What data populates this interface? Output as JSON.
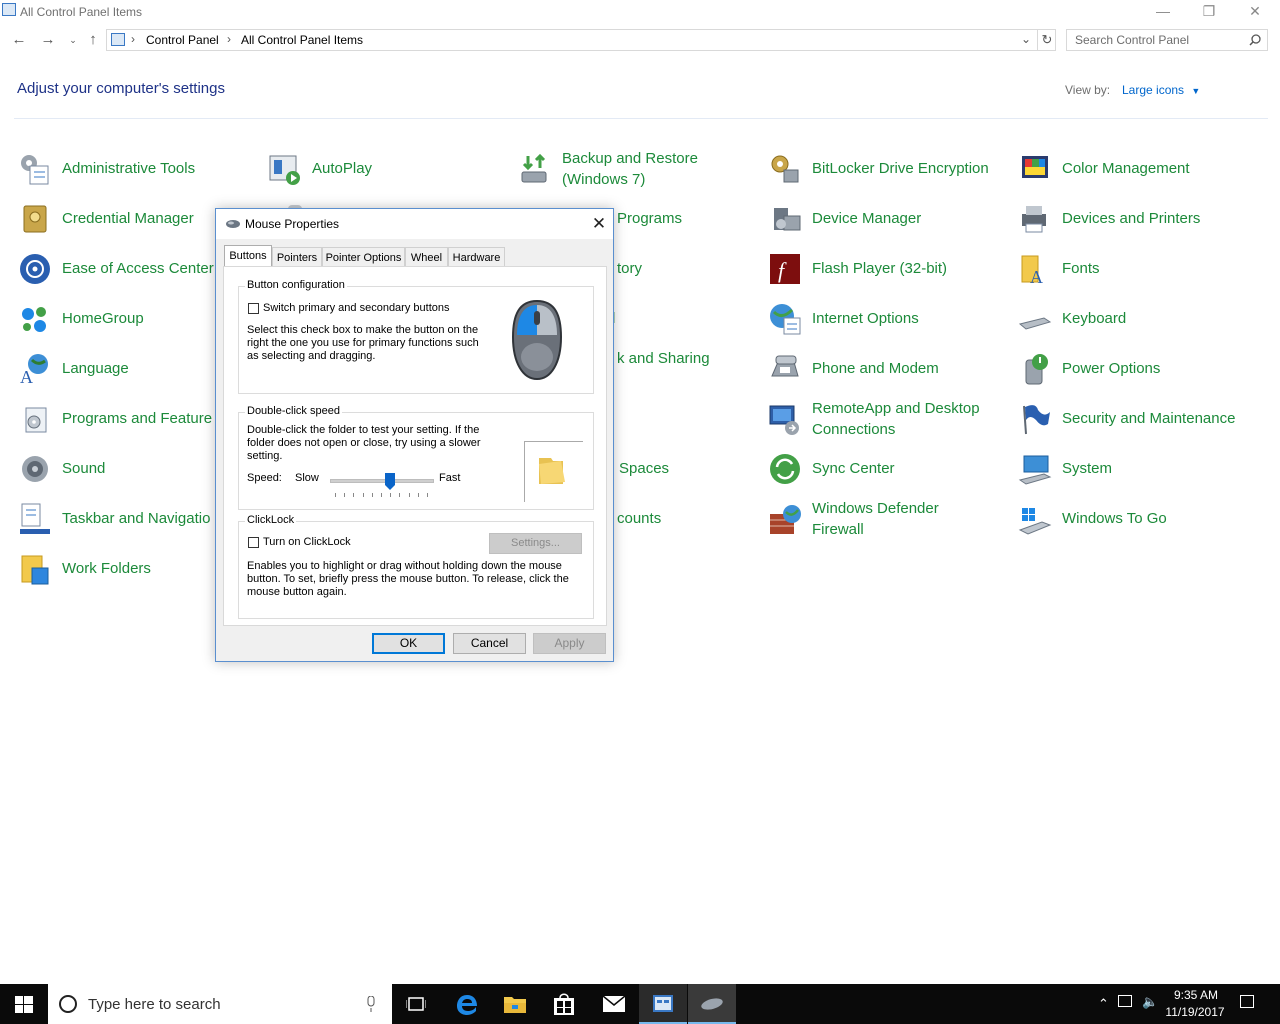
{
  "window": {
    "title": "All Control Panel Items",
    "minimize_glyph": "—",
    "restore_glyph": "❐",
    "close_glyph": "✕"
  },
  "address": {
    "crumbs": [
      "Control Panel",
      "All Control Panel Items"
    ],
    "search_placeholder": "Search Control Panel"
  },
  "header": {
    "title": "Adjust your computer's settings",
    "view_by_label": "View by:",
    "view_by_value": "Large icons"
  },
  "items": {
    "administrative_tools": "Administrative Tools",
    "autoplay": "AutoPlay",
    "backup_restore_1": "Backup and Restore",
    "backup_restore_2": "(Windows 7)",
    "bitlocker": "BitLocker Drive Encryption",
    "color_management": "Color Management",
    "credential_manager": "Credential Manager",
    "default_programs_partial": "Programs",
    "device_manager": "Device Manager",
    "devices_printers": "Devices and Printers",
    "ease_of_access": "Ease of Access Center",
    "file_history_partial": "tory",
    "flash_player": "Flash Player (32-bit)",
    "fonts": "Fonts",
    "homegroup": "HomeGroup",
    "indexing_partial": "l",
    "internet_options": "Internet Options",
    "keyboard": "Keyboard",
    "language": "Language",
    "network_sharing_partial": "k and Sharing",
    "phone_modem": "Phone and Modem",
    "power_options": "Power Options",
    "programs_features": "Programs and Feature",
    "remoteapp_1": "RemoteApp and Desktop",
    "remoteapp_2": "Connections",
    "security_maintenance": "Security and Maintenance",
    "sound": "Sound",
    "storage_spaces_partial": "Spaces",
    "sync_center": "Sync Center",
    "system": "System",
    "taskbar_navigation": "Taskbar and Navigatio",
    "user_accounts_partial": "counts",
    "windows_defender_1": "Windows Defender",
    "windows_defender_2": "Firewall",
    "windows_to_go": "Windows To Go",
    "work_folders": "Work Folders"
  },
  "dialog": {
    "title": "Mouse Properties",
    "close_glyph": "✕",
    "tabs": [
      "Buttons",
      "Pointers",
      "Pointer Options",
      "Wheel",
      "Hardware"
    ],
    "active_tab": "Buttons",
    "button_config": {
      "title": "Button configuration",
      "checkbox_label": "Switch primary and secondary buttons",
      "desc_lines": [
        "Select this check box to make the button on the",
        "right the one you use for primary functions such",
        "as selecting and dragging."
      ]
    },
    "double_click": {
      "title": "Double-click speed",
      "desc_lines": [
        "Double-click the folder to test your setting. If the",
        "folder does not open or close, try using a slower",
        "setting."
      ],
      "speed_label": "Speed:",
      "slow_label": "Slow",
      "fast_label": "Fast",
      "slider_value": 0.6
    },
    "clicklock": {
      "title": "ClickLock",
      "checkbox_label": "Turn on ClickLock",
      "settings_button": "Settings...",
      "desc_lines": [
        "Enables you to highlight or drag without holding down the mouse",
        "button. To set, briefly press the mouse button. To release, click the",
        "mouse button again."
      ]
    },
    "ok": "OK",
    "cancel": "Cancel",
    "apply": "Apply"
  },
  "taskbar": {
    "search_placeholder": "Type here to search",
    "time": "9:35 AM",
    "date": "11/19/2017"
  }
}
